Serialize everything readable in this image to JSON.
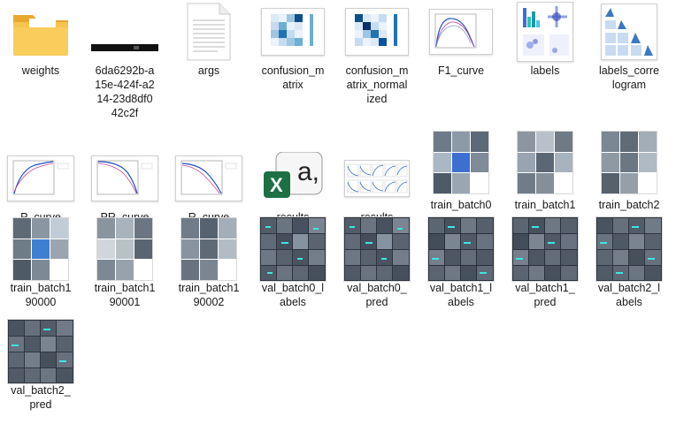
{
  "files": [
    {
      "label": "weights",
      "icon": "folder-icon"
    },
    {
      "label": "6da6292b-a\n15e-424f-a2\n14-23d8df0\n42c2f",
      "icon": "file-icon"
    },
    {
      "label": "args",
      "icon": "text-file-icon"
    },
    {
      "label": "confusion_m\natrix",
      "icon": "image-thumbnail-icon"
    },
    {
      "label": "confusion_m\natrix_normal\nized",
      "icon": "image-thumbnail-icon"
    },
    {
      "label": "F1_curve",
      "icon": "image-thumbnail-icon"
    },
    {
      "label": "labels",
      "icon": "image-thumbnail-icon"
    },
    {
      "label": "labels_corre\nlogram",
      "icon": "image-thumbnail-icon"
    },
    {
      "label": "P_curve",
      "icon": "image-thumbnail-icon"
    },
    {
      "label": "PR_curve",
      "icon": "image-thumbnail-icon"
    },
    {
      "label": "R_curve",
      "icon": "image-thumbnail-icon"
    },
    {
      "label": "results",
      "icon": "excel-icon"
    },
    {
      "label": "results",
      "icon": "image-thumbnail-icon"
    },
    {
      "label": "train_batch0",
      "icon": "image-thumbnail-icon"
    },
    {
      "label": "train_batch1",
      "icon": "image-thumbnail-icon"
    },
    {
      "label": "train_batch2",
      "icon": "image-thumbnail-icon"
    },
    {
      "label": "train_batch1\n90000",
      "icon": "image-thumbnail-icon"
    },
    {
      "label": "train_batch1\n90001",
      "icon": "image-thumbnail-icon"
    },
    {
      "label": "train_batch1\n90002",
      "icon": "image-thumbnail-icon"
    },
    {
      "label": "val_batch0_l\nabels",
      "icon": "image-thumbnail-icon"
    },
    {
      "label": "val_batch0_\npred",
      "icon": "image-thumbnail-icon"
    },
    {
      "label": "val_batch1_l\nabels",
      "icon": "image-thumbnail-icon"
    },
    {
      "label": "val_batch1_\npred",
      "icon": "image-thumbnail-icon"
    },
    {
      "label": "val_batch2_l\nabels",
      "icon": "image-thumbnail-icon"
    },
    {
      "label": "val_batch2_\npred",
      "icon": "image-thumbnail-icon"
    }
  ],
  "colors": {
    "folder": "#f3c14b",
    "excel": "#1d7044",
    "accent": "#3b7bbf"
  }
}
